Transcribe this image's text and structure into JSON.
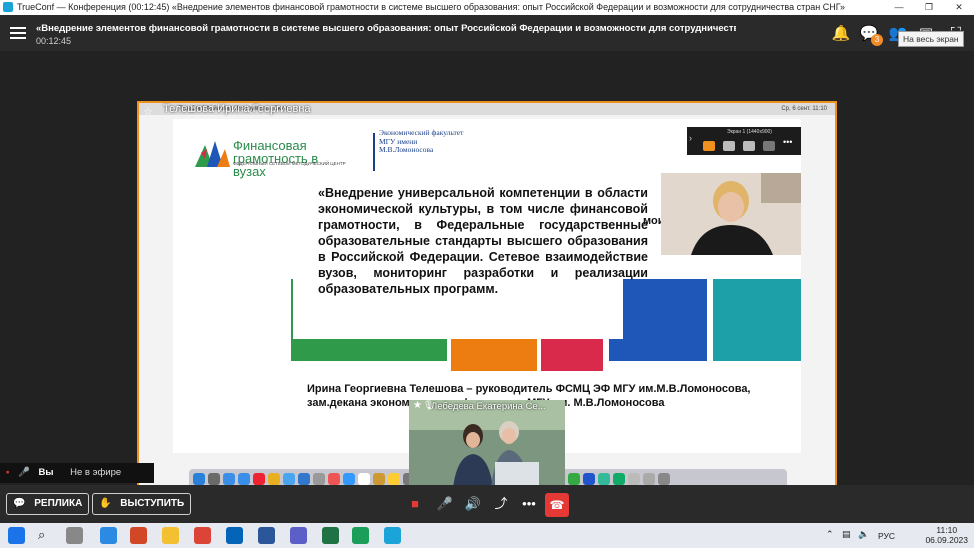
{
  "window": {
    "title": "TrueConf — Конференция (00:12:45) «Внедрение элементов финансовой грамотности в системе высшего образования: опыт Российской Федерации и возможности для сотрудничества стран СНГ»"
  },
  "header": {
    "conference_title": "«Внедрение элементов финансовой грамотности в системе высшего образования: опыт Российской Федерации и возможности для сотрудничества стран СНГ»",
    "timer": "00:12:45",
    "notification_count": "3",
    "fullscreen_tooltip": "На весь экран"
  },
  "stage": {
    "presenter_name": "Телешова Ирина Георгиевна",
    "mac_menu": "TrueConf   Файл   Вид   Инструменты   Окно",
    "mac_clock": "Ср, 6 сент.  11:10",
    "zoom_panel_label": "Экран 1 (1440x900)",
    "second_participant_name": "Лебедева Екатерина Се...",
    "local_status": {
      "you": "Вы",
      "state": "Не в эфире"
    }
  },
  "slide": {
    "logo_title": "Финансовая грамотность в вузах",
    "logo_subtitle": "ФЕДЕРАЛЬНЫЙ СЕТЕВОЙ МЕТОДИЧЕСКИЙ ЦЕНТР",
    "mgu_lines": "Экономический факультет МГУ имени М.В.Ломоносова",
    "quote": "«Внедрение универсальной компетенции в области экономической культуры, в том числе финансовой грамотности, в Федеральные государственные образовательные стандарты высшего образования в Российской Федерации. Сетевое взаимодействие вузов, мониторинг разработки и реализации образовательных программ.",
    "corner_text": "мои финансы",
    "speaker": "Ирина Георгиевна Телешова – руководитель ФСМЦ ЭФ МГУ им.М.В.Ломоносова, зам.декана экономического факультета МГУ им. М.В.Ломоносова",
    "band_colors": [
      "#ffffff",
      "#2e9a4a",
      "#ee7d11",
      "#d92a4b",
      "#1e57b8",
      "#1ea0a8"
    ]
  },
  "toolbar": {
    "reply_label": "РЕПЛИКА",
    "speak_label": "ВЫСТУПИТЬ"
  },
  "taskbar": {
    "language": "РУС",
    "time": "11:10",
    "date": "06.09.2023"
  },
  "colors": {
    "accent_orange": "#f0901e",
    "hangup_red": "#e53935"
  }
}
